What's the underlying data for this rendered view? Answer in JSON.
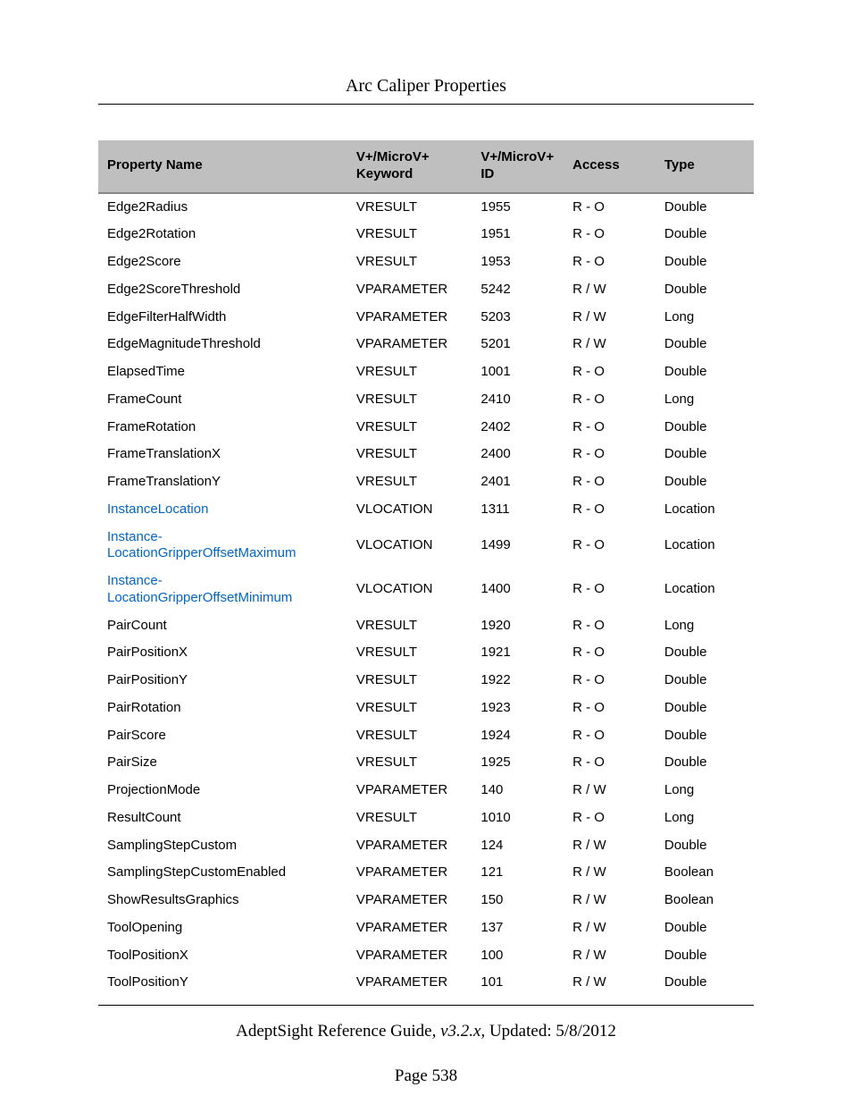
{
  "header": {
    "title": "Arc Caliper Properties"
  },
  "table": {
    "columns": [
      "Property Name",
      "V+/MicroV+ Keyword",
      "V+/MicroV+ ID",
      "Access",
      "Type"
    ],
    "rows": [
      {
        "name": "Edge2Radius",
        "link": false,
        "keyword": "VRESULT",
        "id": "1955",
        "access": "R - O",
        "type": "Double"
      },
      {
        "name": "Edge2Rotation",
        "link": false,
        "keyword": "VRESULT",
        "id": "1951",
        "access": "R - O",
        "type": "Double"
      },
      {
        "name": "Edge2Score",
        "link": false,
        "keyword": "VRESULT",
        "id": "1953",
        "access": "R - O",
        "type": "Double"
      },
      {
        "name": "Edge2ScoreThreshold",
        "link": false,
        "keyword": "VPARAMETER",
        "id": "5242",
        "access": "R / W",
        "type": "Double"
      },
      {
        "name": "EdgeFilterHalfWidth",
        "link": false,
        "keyword": "VPARAMETER",
        "id": "5203",
        "access": "R / W",
        "type": "Long"
      },
      {
        "name": "EdgeMagnitudeThreshold",
        "link": false,
        "keyword": "VPARAMETER",
        "id": "5201",
        "access": "R / W",
        "type": "Double"
      },
      {
        "name": "ElapsedTime",
        "link": false,
        "keyword": "VRESULT",
        "id": "1001",
        "access": "R - O",
        "type": "Double"
      },
      {
        "name": "FrameCount",
        "link": false,
        "keyword": "VRESULT",
        "id": "2410",
        "access": "R - O",
        "type": "Long"
      },
      {
        "name": "FrameRotation",
        "link": false,
        "keyword": "VRESULT",
        "id": "2402",
        "access": "R - O",
        "type": "Double"
      },
      {
        "name": "FrameTranslationX",
        "link": false,
        "keyword": "VRESULT",
        "id": "2400",
        "access": "R - O",
        "type": "Double"
      },
      {
        "name": "FrameTranslationY",
        "link": false,
        "keyword": "VRESULT",
        "id": "2401",
        "access": "R - O",
        "type": "Double"
      },
      {
        "name": "InstanceLocation",
        "link": true,
        "keyword": "VLOCATION",
        "id": "1311",
        "access": "R - O",
        "type": "Location"
      },
      {
        "name": "Instance-LocationGripperOffsetMaximum",
        "link": true,
        "keyword": "VLOCATION",
        "id": "1499",
        "access": "R - O",
        "type": "Location"
      },
      {
        "name": "Instance-LocationGripperOffsetMinimum",
        "link": true,
        "keyword": "VLOCATION",
        "id": "1400",
        "access": "R - O",
        "type": "Location"
      },
      {
        "name": "PairCount",
        "link": false,
        "keyword": "VRESULT",
        "id": "1920",
        "access": "R - O",
        "type": "Long"
      },
      {
        "name": "PairPositionX",
        "link": false,
        "keyword": "VRESULT",
        "id": "1921",
        "access": "R - O",
        "type": "Double"
      },
      {
        "name": "PairPositionY",
        "link": false,
        "keyword": "VRESULT",
        "id": "1922",
        "access": "R - O",
        "type": "Double"
      },
      {
        "name": "PairRotation",
        "link": false,
        "keyword": "VRESULT",
        "id": "1923",
        "access": "R - O",
        "type": "Double"
      },
      {
        "name": "PairScore",
        "link": false,
        "keyword": "VRESULT",
        "id": "1924",
        "access": "R - O",
        "type": "Double"
      },
      {
        "name": "PairSize",
        "link": false,
        "keyword": "VRESULT",
        "id": "1925",
        "access": "R - O",
        "type": "Double"
      },
      {
        "name": "ProjectionMode",
        "link": false,
        "keyword": "VPARAMETER",
        "id": "140",
        "access": "R / W",
        "type": "Long"
      },
      {
        "name": "ResultCount",
        "link": false,
        "keyword": "VRESULT",
        "id": "1010",
        "access": "R - O",
        "type": "Long"
      },
      {
        "name": "SamplingStepCustom",
        "link": false,
        "keyword": "VPARAMETER",
        "id": "124",
        "access": "R / W",
        "type": "Double"
      },
      {
        "name": "SamplingStepCustomEnabled",
        "link": false,
        "keyword": "VPARAMETER",
        "id": "121",
        "access": "R / W",
        "type": "Boolean"
      },
      {
        "name": "ShowResultsGraphics",
        "link": false,
        "keyword": "VPARAMETER",
        "id": "150",
        "access": "R / W",
        "type": "Boolean"
      },
      {
        "name": "ToolOpening",
        "link": false,
        "keyword": "VPARAMETER",
        "id": "137",
        "access": "R / W",
        "type": "Double"
      },
      {
        "name": "ToolPositionX",
        "link": false,
        "keyword": "VPARAMETER",
        "id": "100",
        "access": "R / W",
        "type": "Double"
      },
      {
        "name": "ToolPositionY",
        "link": false,
        "keyword": "VPARAMETER",
        "id": "101",
        "access": "R / W",
        "type": "Double"
      }
    ]
  },
  "footer": {
    "guide": "AdeptSight Reference Guide",
    "version": ", v3.2.x",
    "updated": ", Updated: 5/8/2012",
    "page": "Page 538"
  }
}
